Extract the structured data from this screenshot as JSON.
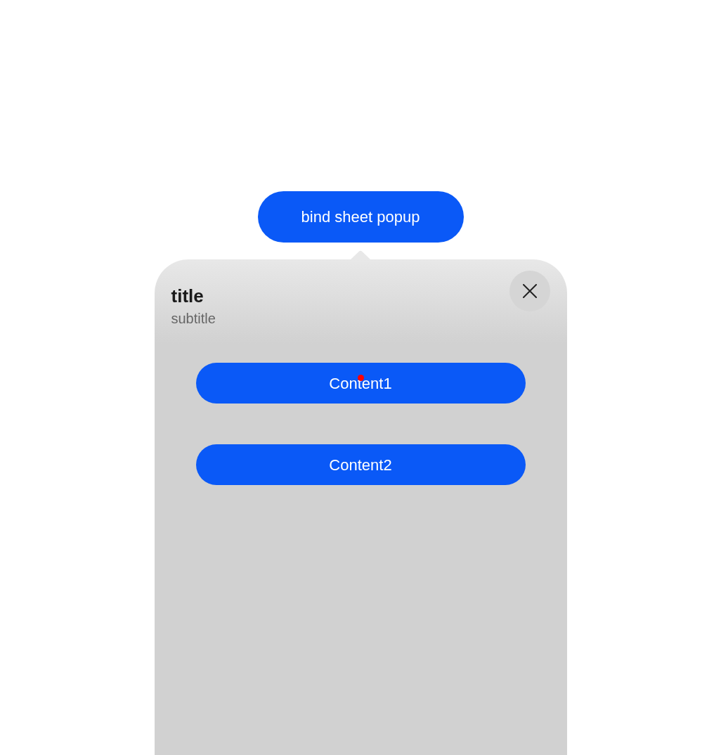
{
  "trigger_button": {
    "label": "bind sheet popup"
  },
  "sheet": {
    "title": "title",
    "subtitle": "subtitle",
    "content_buttons": [
      {
        "label": "Content1",
        "touched": true
      },
      {
        "label": "Content2",
        "touched": false
      }
    ]
  }
}
